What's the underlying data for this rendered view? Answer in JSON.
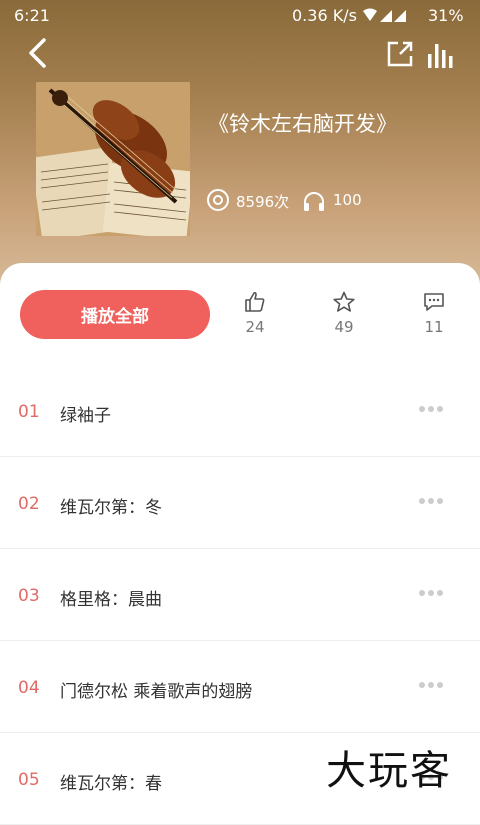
{
  "status_bar": {
    "time": "6:21",
    "network": "0.36 K/s",
    "battery": "31%"
  },
  "album": {
    "title": "《铃木左右脑开发》",
    "play_count": "8596次",
    "listeners": "100"
  },
  "actions": {
    "play_all": "播放全部",
    "likes": "24",
    "favorites": "49",
    "comments": "11"
  },
  "tracks": [
    {
      "num": "01",
      "name": "绿袖子"
    },
    {
      "num": "02",
      "name": "维瓦尔第：冬"
    },
    {
      "num": "03",
      "name": "格里格：晨曲"
    },
    {
      "num": "04",
      "name": "门德尔松 乘着歌声的翅膀"
    },
    {
      "num": "05",
      "name": "维瓦尔第：春"
    }
  ],
  "watermark": "大玩客",
  "colors": {
    "accent": "#f0605c",
    "track_number": "#e06a66",
    "header_top": "#8a6a3a"
  }
}
